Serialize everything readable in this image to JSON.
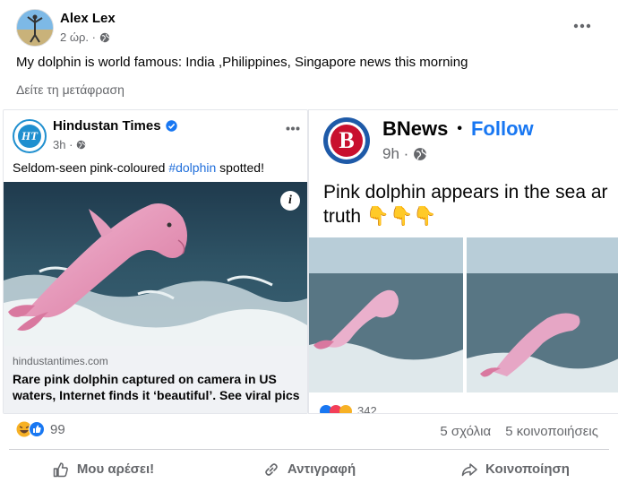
{
  "post": {
    "author": "Alex Lex",
    "time": "2 ώρ. ·",
    "text": "My dolphin is world famous: India ,Philippines, Singapore news this morning",
    "translate": "Δείτε τη μετάφραση"
  },
  "card_left": {
    "source_name": "Hindustan Times",
    "time": "3h ·",
    "headline_prefix": "Seldom-seen pink-coloured ",
    "hashtag": "#dolphin",
    "headline_suffix": " spotted!",
    "link_domain": "hindustantimes.com",
    "link_title": "Rare pink dolphin captured on camera in US waters, Internet finds it ‘beautiful’. See viral pics",
    "info_icon": "i",
    "logo_text": "HT"
  },
  "card_right": {
    "source_name": "BNews",
    "dot": "•",
    "follow": "Follow",
    "time": "9h ·",
    "logo_letter": "B",
    "text": "Pink dolphin appears in the sea ar truth",
    "emojis": "👇👇👇",
    "counter_partial": "342"
  },
  "stats": {
    "reaction_count": "99",
    "comments": "5 σχόλια",
    "shares": "5 κοινοποιήσεις"
  },
  "actions": {
    "like": "Μου αρέσει!",
    "copy": "Αντιγραφή",
    "share": "Κοινοποίηση"
  },
  "colors": {
    "link_blue": "#216fdb",
    "follow_blue": "#1877f2",
    "bnews_red": "#c8102e"
  }
}
